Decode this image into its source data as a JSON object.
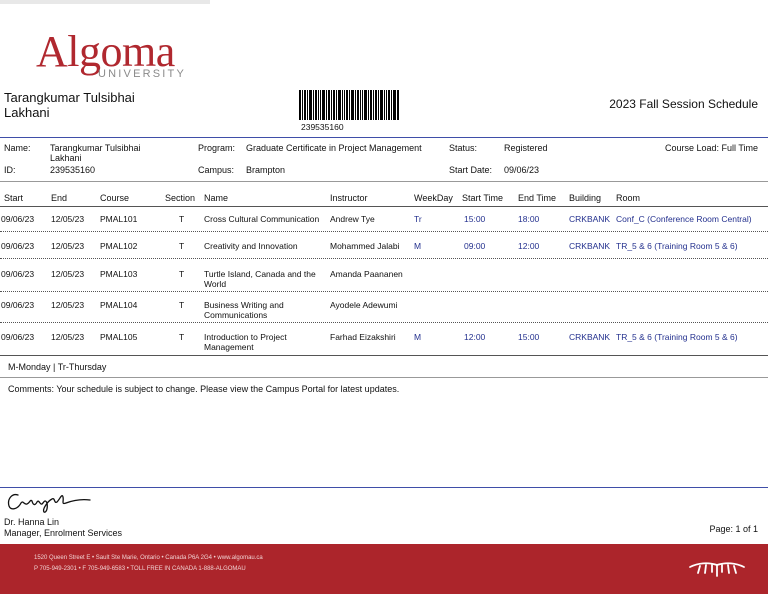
{
  "logo": {
    "word": "Algoma",
    "sub": "UNIVERSITY"
  },
  "header": {
    "student_name_line1": "Tarangkumar Tulsibhai",
    "student_name_line2": "Lakhani",
    "barcode_number": "239535160",
    "session_title": "2023 Fall Session Schedule"
  },
  "info": {
    "name_label": "Name:",
    "name_line1": "Tarangkumar Tulsibhai",
    "name_line2": "Lakhani",
    "id_label": "ID:",
    "id_value": "239535160",
    "program_label": "Program:",
    "program_value": "Graduate Certificate in Project Management",
    "campus_label": "Campus:",
    "campus_value": "Brampton",
    "status_label": "Status:",
    "status_value": "Registered",
    "start_date_label": "Start Date:",
    "start_date_value": "09/06/23",
    "course_load": "Course Load: Full Time"
  },
  "table": {
    "headers": {
      "start": "Start",
      "end": "End",
      "course": "Course",
      "section": "Section",
      "name": "Name",
      "instructor": "Instructor",
      "weekday": "WeekDay",
      "start_time": "Start Time",
      "end_time": "End Time",
      "building": "Building",
      "room": "Room"
    },
    "rows": [
      {
        "start": "09/06/23",
        "end": "12/05/23",
        "course": "PMAL101",
        "section": "T",
        "name1": "Cross Cultural Communication",
        "name2": "",
        "instructor": "Andrew Tye",
        "weekday": "Tr",
        "start_time": "15:00",
        "end_time": "18:00",
        "building": "CRKBANK",
        "room": "Conf_C (Conference Room Central)"
      },
      {
        "start": "09/06/23",
        "end": "12/05/23",
        "course": "PMAL102",
        "section": "T",
        "name1": "Creativity and Innovation",
        "name2": "",
        "instructor": "Mohammed Jalabi",
        "weekday": "M",
        "start_time": "09:00",
        "end_time": "12:00",
        "building": "CRKBANK",
        "room": "TR_5 & 6 (Training Room 5 & 6)"
      },
      {
        "start": "09/06/23",
        "end": "12/05/23",
        "course": "PMAL103",
        "section": "T",
        "name1": "Turtle Island, Canada and the",
        "name2": "World",
        "instructor": "Amanda Paananen",
        "weekday": "",
        "start_time": "",
        "end_time": "",
        "building": "",
        "room": ""
      },
      {
        "start": "09/06/23",
        "end": "12/05/23",
        "course": "PMAL104",
        "section": "T",
        "name1": "Business Writing and",
        "name2": "Communications",
        "instructor": "Ayodele Adewumi",
        "weekday": "",
        "start_time": "",
        "end_time": "",
        "building": "",
        "room": ""
      },
      {
        "start": "09/06/23",
        "end": "12/05/23",
        "course": "PMAL105",
        "section": "T",
        "name1": "Introduction to Project",
        "name2": "Management",
        "instructor": "Farhad Eizakshiri",
        "weekday": "M",
        "start_time": "12:00",
        "end_time": "15:00",
        "building": "CRKBANK",
        "room": "TR_5 & 6 (Training Room 5 & 6)"
      }
    ]
  },
  "legend": "M-Monday | Tr-Thursday",
  "comments": "Comments:  Your schedule is subject to change.  Please view the Campus Portal for latest updates.",
  "signature": {
    "name": "Dr. Hanna Lin",
    "title": "Manager, Enrolment Services",
    "script_text": "Hanna Lin"
  },
  "page_number": "Page: 1 of 1",
  "footer": {
    "line1": "1520 Queen Street E • Sault Ste Marie, Ontario • Canada P6A 2G4 • www.algomau.ca",
    "line2": "P 705-949-2301 • F 705-949-6583 • TOLL FREE IN CANADA 1-888-ALGOMAU"
  },
  "colors": {
    "brand_red": "#ac252b",
    "rule_blue": "#3f4ea8",
    "value_blue": "#23308e"
  }
}
